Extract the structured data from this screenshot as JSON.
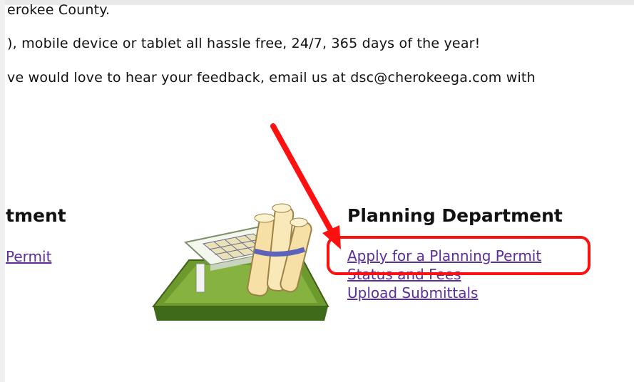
{
  "intro": {
    "line1": "erokee County.",
    "line2": "), mobile device or tablet all hassle free, 24/7, 365 days of the year!",
    "line3": "ve would love to hear your feedback, email us at dsc@cherokeega.com with"
  },
  "left_section": {
    "heading": "tment",
    "link": "Permit"
  },
  "planning": {
    "heading": "Planning Department",
    "links": [
      "Apply for a Planning Permit",
      "Status and Fees",
      "Upload Submittals"
    ]
  },
  "colors": {
    "link": "#5b2e9c",
    "annotation": "#ff1010"
  },
  "icons": {
    "illustration": "blueprint-scrolls-icon",
    "annotation_arrow": "red-arrow"
  }
}
